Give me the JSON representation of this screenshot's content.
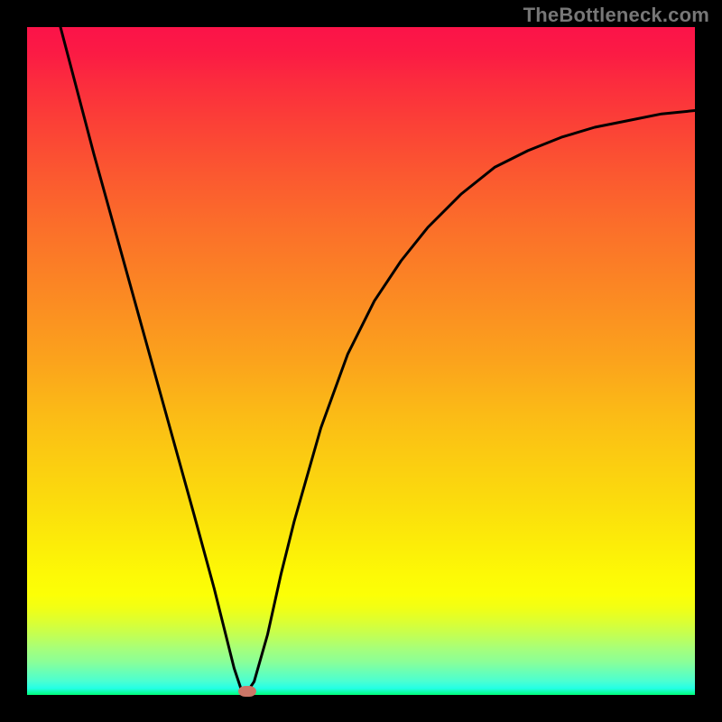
{
  "watermark": "TheBottleneck.com",
  "chart_data": {
    "type": "line",
    "title": "",
    "xlabel": "",
    "ylabel": "",
    "xlim": [
      0,
      100
    ],
    "ylim": [
      0,
      100
    ],
    "series": [
      {
        "name": "curve",
        "x": [
          5,
          10,
          15,
          20,
          25,
          28,
          30,
          31,
          32,
          33,
          34,
          36,
          38,
          40,
          44,
          48,
          52,
          56,
          60,
          65,
          70,
          75,
          80,
          85,
          90,
          95,
          100
        ],
        "y": [
          100,
          81,
          63,
          45,
          27,
          16,
          8,
          4,
          1,
          0.5,
          2,
          9,
          18,
          26,
          40,
          51,
          59,
          65,
          70,
          75,
          79,
          81.5,
          83.5,
          85,
          86,
          87,
          87.5
        ]
      }
    ],
    "marker": {
      "x": 33,
      "y": 0.5
    },
    "background_gradient": {
      "top": "#fb1349",
      "upper_mid": "#fba31c",
      "lower_mid": "#fcff06",
      "bottom": "#00ff79"
    },
    "frame_color": "#000000",
    "curve_color": "#000000",
    "marker_color": "#cd7667"
  }
}
